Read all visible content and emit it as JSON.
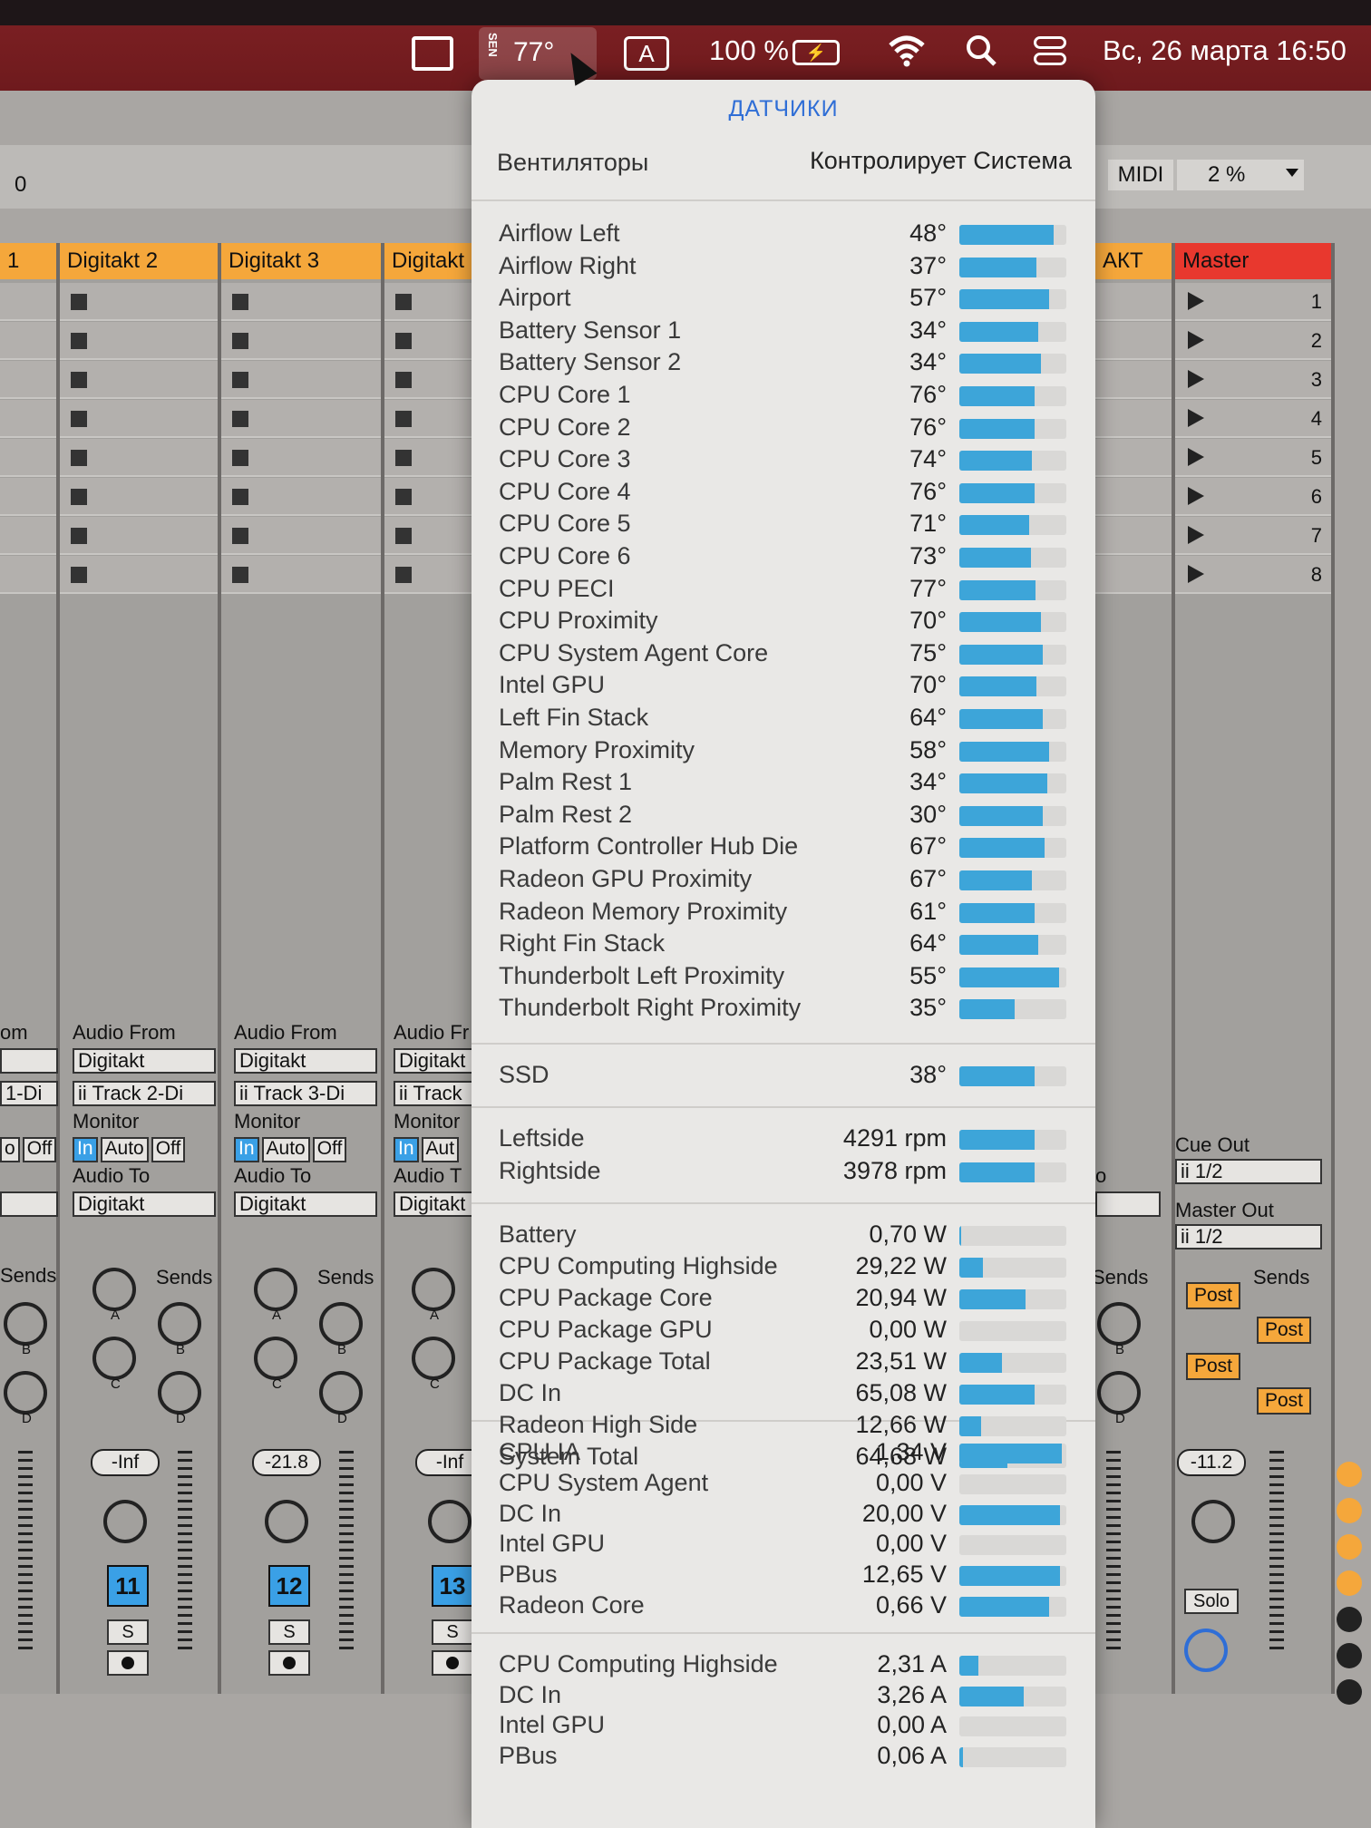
{
  "menubar": {
    "sensor_label": "SEN",
    "sensor_value": "77°",
    "input_source": "A",
    "battery_pct": "100 %",
    "battery_icon_text": "⚡",
    "wifi_icon": "wifi-icon",
    "search_icon": "search-icon",
    "datetime": "Вс, 26 марта  16:50"
  },
  "ableton": {
    "toolbar_value": "0",
    "midi_label": "MIDI",
    "cpu_label": "2 %",
    "tracks": [
      {
        "name": "",
        "vol": "",
        "num": ""
      },
      {
        "name": "Digitakt 2",
        "vol": "-Inf",
        "num": "11",
        "track_in": "ii Track 2-Di"
      },
      {
        "name": "Digitakt 3",
        "vol": "-21.8",
        "num": "12",
        "track_in": "ii Track 3-Di"
      },
      {
        "name": "Digitakt",
        "vol": "-Inf",
        "num": "13",
        "track_in": "ii Track"
      }
    ],
    "right_track_name": "АКТ",
    "master_name": "Master",
    "master_vol": "-11.2",
    "scenes": [
      "1",
      "2",
      "3",
      "4",
      "5",
      "6",
      "7",
      "8"
    ],
    "audio_from": "Audio From",
    "audio_from_short": "Audio Fr",
    "audio_from_prefix": "om",
    "digitakt": "Digitakt",
    "digitakt_short": "Digitakt",
    "left_track_in": "1-Di",
    "monitor": "Monitor",
    "mon_in": "In",
    "mon_auto": "Auto",
    "mon_off": "Off",
    "mon_aut_short": "Aut",
    "mon_prefix": "o",
    "audio_to": "Audio To",
    "audio_to_short": "Audio T",
    "sends": "Sends",
    "cue_out": "Cue Out",
    "cue_out_val": "ii 1/2",
    "master_out": "Master Out",
    "master_out_val": "ii 1/2",
    "post": "Post",
    "solo": "Solo",
    "s_btn": "S",
    "knob_a": "A",
    "knob_b": "B",
    "knob_c": "C",
    "knob_d": "D",
    "right_o": "o"
  },
  "popup": {
    "title": "ДАТЧИКИ",
    "fans_label": "Вентиляторы",
    "fans_mode": "Контролирует Система",
    "temperatures": [
      {
        "name": "Airflow Left",
        "value": "48°",
        "level": 0.88
      },
      {
        "name": "Airflow Right",
        "value": "37°",
        "level": 0.72
      },
      {
        "name": "Airport",
        "value": "57°",
        "level": 0.84
      },
      {
        "name": "Battery Sensor 1",
        "value": "34°",
        "level": 0.74
      },
      {
        "name": "Battery Sensor 2",
        "value": "34°",
        "level": 0.76
      },
      {
        "name": "CPU Core 1",
        "value": "76°",
        "level": 0.7
      },
      {
        "name": "CPU Core 2",
        "value": "76°",
        "level": 0.7
      },
      {
        "name": "CPU Core 3",
        "value": "74°",
        "level": 0.68
      },
      {
        "name": "CPU Core 4",
        "value": "76°",
        "level": 0.7
      },
      {
        "name": "CPU Core 5",
        "value": "71°",
        "level": 0.65
      },
      {
        "name": "CPU Core 6",
        "value": "73°",
        "level": 0.67
      },
      {
        "name": "CPU PECI",
        "value": "77°",
        "level": 0.71
      },
      {
        "name": "CPU Proximity",
        "value": "70°",
        "level": 0.76
      },
      {
        "name": "CPU System Agent Core",
        "value": "75°",
        "level": 0.78
      },
      {
        "name": "Intel GPU",
        "value": "70°",
        "level": 0.72
      },
      {
        "name": "Left Fin Stack",
        "value": "64°",
        "level": 0.78
      },
      {
        "name": "Memory Proximity",
        "value": "58°",
        "level": 0.84
      },
      {
        "name": "Palm Rest 1",
        "value": "34°",
        "level": 0.82
      },
      {
        "name": "Palm Rest 2",
        "value": "30°",
        "level": 0.78
      },
      {
        "name": "Platform Controller Hub Die",
        "value": "67°",
        "level": 0.8
      },
      {
        "name": "Radeon GPU Proximity",
        "value": "67°",
        "level": 0.68
      },
      {
        "name": "Radeon Memory Proximity",
        "value": "61°",
        "level": 0.7
      },
      {
        "name": "Right Fin Stack",
        "value": "64°",
        "level": 0.74
      },
      {
        "name": "Thunderbolt Left Proximity",
        "value": "55°",
        "level": 0.93
      },
      {
        "name": "Thunderbolt Right Proximity",
        "value": "35°",
        "level": 0.52
      }
    ],
    "ssd": [
      {
        "name": "SSD",
        "value": "38°",
        "level": 0.7
      }
    ],
    "fans": [
      {
        "name": "Leftside",
        "value": "4291 rpm",
        "level": 0.7
      },
      {
        "name": "Rightside",
        "value": "3978 rpm",
        "level": 0.7
      }
    ],
    "power": [
      {
        "name": "Battery",
        "value": "0,70 W",
        "level": 0.02
      },
      {
        "name": "CPU Computing Highside",
        "value": "29,22 W",
        "level": 0.22
      },
      {
        "name": "CPU Package Core",
        "value": "20,94 W",
        "level": 0.62
      },
      {
        "name": "CPU Package GPU",
        "value": "0,00 W",
        "level": 0.0
      },
      {
        "name": "CPU Package Total",
        "value": "23,51 W",
        "level": 0.4
      },
      {
        "name": "DC In",
        "value": "65,08 W",
        "level": 0.7
      },
      {
        "name": "Radeon High Side",
        "value": "12,66 W",
        "level": 0.2
      },
      {
        "name": "System Total",
        "value": "64,68 W",
        "level": 0.45
      }
    ],
    "voltage": [
      {
        "name": "CPU IA",
        "value": "1,34 V",
        "level": 0.96
      },
      {
        "name": "CPU System Agent",
        "value": "0,00 V",
        "level": 0.0
      },
      {
        "name": "DC In",
        "value": "20,00 V",
        "level": 0.94
      },
      {
        "name": "Intel GPU",
        "value": "0,00 V",
        "level": 0.0
      },
      {
        "name": "PBus",
        "value": "12,65 V",
        "level": 0.94
      },
      {
        "name": "Radeon Core",
        "value": "0,66 V",
        "level": 0.84
      }
    ],
    "current": [
      {
        "name": "CPU Computing Highside",
        "value": "2,31 A",
        "level": 0.18
      },
      {
        "name": "DC In",
        "value": "3,26 A",
        "level": 0.6
      },
      {
        "name": "Intel GPU",
        "value": "0,00 A",
        "level": 0.0
      },
      {
        "name": "PBus",
        "value": "0,06 A",
        "level": 0.03
      }
    ],
    "colors": {
      "bar": "#3da5d9",
      "title": "#2f6ed6"
    }
  }
}
